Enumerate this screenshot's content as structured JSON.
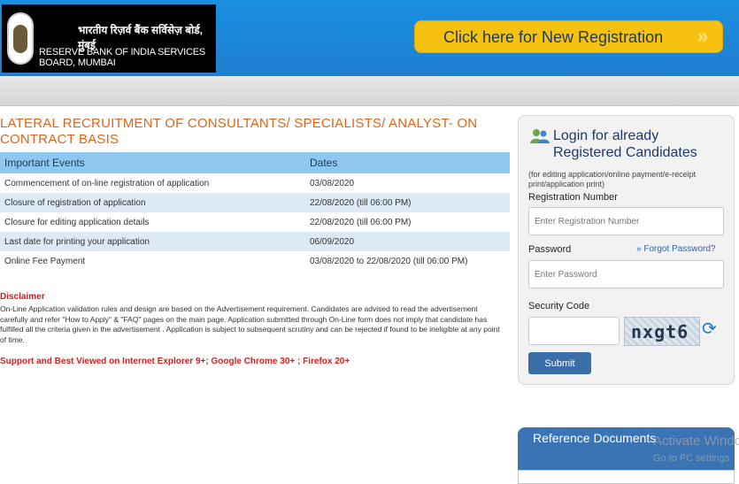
{
  "header": {
    "logo_hindi": "भारतीय रिज़र्व बैंक सर्विसेज़ बोर्ड, मुंबई",
    "logo_english": "RESERVE BANK OF INDIA SERVICES BOARD, MUMBAI",
    "register_button": "Click here for New Registration",
    "register_arrow": "»"
  },
  "page_title": "LATERAL RECRUITMENT OF CONSULTANTS/ SPECIALISTS/ ANALYST- ON CONTRACT BASIS",
  "events_table": {
    "headers": [
      "Important Events",
      "Dates"
    ],
    "rows": [
      [
        "Commencement of on-line registration of application",
        "03/08/2020"
      ],
      [
        "Closure of registration of application",
        "22/08/2020 (till 06:00 PM)"
      ],
      [
        "Closure for editing application details",
        "22/08/2020 (till 06:00 PM)"
      ],
      [
        "Last date for printing your application",
        "06/09/2020"
      ],
      [
        "Online Fee Payment",
        "03/08/2020 to 22/08/2020 (till 06:00 PM)"
      ]
    ]
  },
  "disclaimer": {
    "title": "Disclaimer",
    "text": "On-Line Application validation rules and design are based on the Advertisement requirement. Candidates are advised to read the advertisement carefully and refer \"How to Apply\" & \"FAQ\" pages on the main page. Application submitted through On-Line form does not imply that candidate has fulfilled all the criteria given in the advertisement . Application is subject to subsequent scrutiny and can be rejected if found to be ineligible at any point of time."
  },
  "support_text": "Support and Best Viewed on Internet Explorer 9+; Google Chrome 30+ ; Firefox 20+",
  "login": {
    "title_line1": "Login for already",
    "title_line2": "Registered Candidates",
    "subtitle": "(for editing application/online payment/e-receipt print/application print)",
    "registration_label": "Registration Number",
    "registration_placeholder": "Enter Registration Number",
    "password_label": "Password",
    "forgot_password": "» Forgot Password?",
    "password_placeholder": "Enter Password",
    "security_label": "Security Code",
    "captcha_text": "nxgt6",
    "submit_label": "Submit"
  },
  "reference_documents": {
    "title": "Reference Documents"
  },
  "watermark": {
    "line1": "Activate Windows",
    "line2": "Go to PC settings"
  }
}
